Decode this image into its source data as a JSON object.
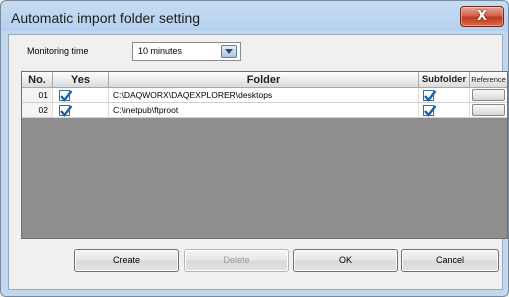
{
  "window": {
    "title": "Automatic import folder setting",
    "close_glyph": "X"
  },
  "monitoring": {
    "label": "Monitoring time",
    "value": "10 minutes"
  },
  "table": {
    "headers": {
      "no": "No.",
      "yes": "Yes",
      "folder": "Folder",
      "subfolder": "Subfolder",
      "reference": "Reference"
    },
    "rows": [
      {
        "no": "01",
        "yes": true,
        "folder": "C:\\DAQWORX\\DAQEXPLORER\\desktops",
        "subfolder": true
      },
      {
        "no": "02",
        "yes": true,
        "folder": "C:\\inetpub\\ftproot",
        "subfolder": true
      }
    ]
  },
  "buttons": {
    "create": "Create",
    "delete": "Delete",
    "ok": "OK",
    "cancel": "Cancel"
  },
  "colors": {
    "check": "#1f5fa8",
    "titlebar": "#b5d0ee",
    "close": "#c0391f",
    "grid_bg": "#8e8e8e"
  },
  "icons": {
    "close": "close-icon",
    "dropdown": "chevron-down-icon",
    "check": "checkmark-icon"
  }
}
